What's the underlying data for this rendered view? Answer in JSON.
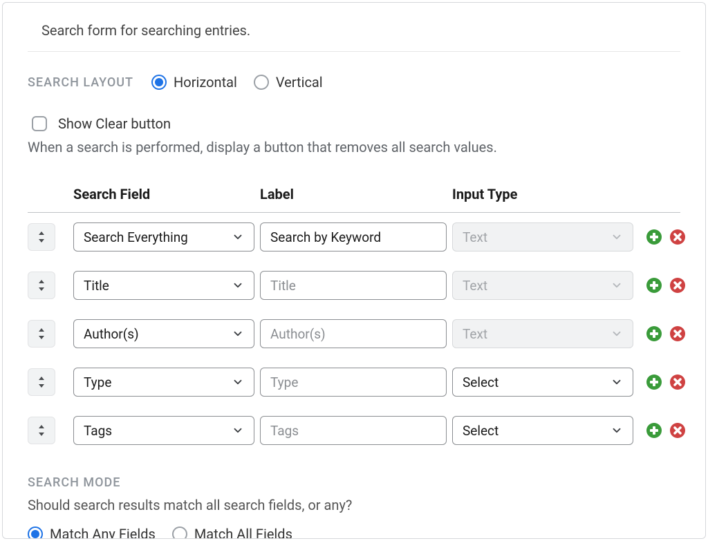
{
  "description": "Search form for searching entries.",
  "search_layout": {
    "label": "SEARCH LAYOUT",
    "options": {
      "horizontal": "Horizontal",
      "vertical": "Vertical"
    },
    "selected": "horizontal"
  },
  "show_clear": {
    "label": "Show Clear button",
    "help": "When a search is performed, display a button that removes all search values.",
    "checked": false
  },
  "table": {
    "headers": {
      "field": "Search Field",
      "label": "Label",
      "input_type": "Input Type"
    },
    "rows": [
      {
        "field": "Search Everything",
        "label": "Search by Keyword",
        "input_type": "Text",
        "input_disabled": true,
        "label_is_placeholder": false
      },
      {
        "field": "Title",
        "label": "Title",
        "input_type": "Text",
        "input_disabled": true,
        "label_is_placeholder": true
      },
      {
        "field": "Author(s)",
        "label": "Author(s)",
        "input_type": "Text",
        "input_disabled": true,
        "label_is_placeholder": true
      },
      {
        "field": "Type",
        "label": "Type",
        "input_type": "Select",
        "input_disabled": false,
        "label_is_placeholder": true
      },
      {
        "field": "Tags",
        "label": "Tags",
        "input_type": "Select",
        "input_disabled": false,
        "label_is_placeholder": true
      }
    ]
  },
  "search_mode": {
    "label": "SEARCH MODE",
    "help": "Should search results match all search fields, or any?",
    "options": {
      "any": "Match Any Fields",
      "all": "Match All Fields"
    },
    "selected": "any"
  }
}
